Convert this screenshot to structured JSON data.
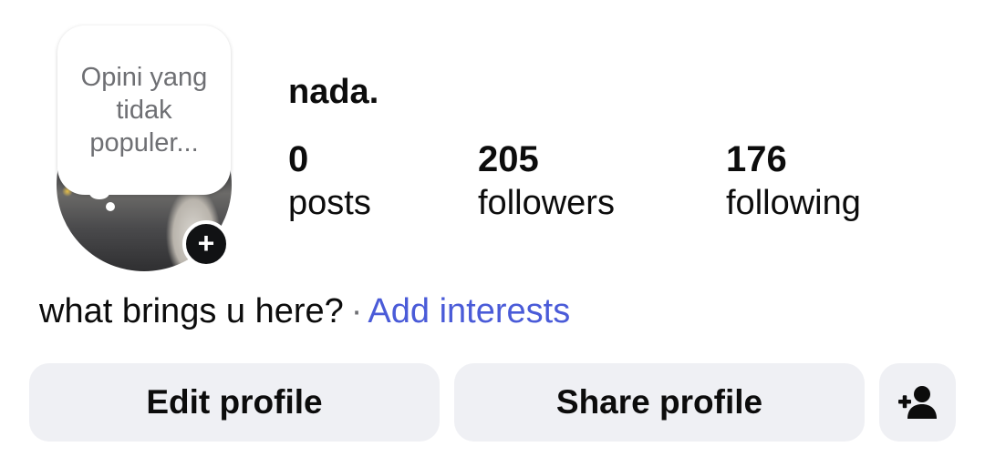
{
  "profile": {
    "note": "Opini yang tidak populer...",
    "username": "nada.",
    "add_story_symbol": "+",
    "stats": [
      {
        "value": "0",
        "label": "posts"
      },
      {
        "value": "205",
        "label": "followers"
      },
      {
        "value": "176",
        "label": "following"
      }
    ],
    "bio_text": "what brings u here?",
    "bio_separator": "·",
    "add_interests": "Add interests"
  },
  "actions": {
    "edit": "Edit profile",
    "share": "Share profile",
    "add_person_icon": "person-add-icon"
  },
  "colors": {
    "button_bg": "#eff0f4",
    "link": "#4a5bd8",
    "muted": "#6e6f73"
  }
}
